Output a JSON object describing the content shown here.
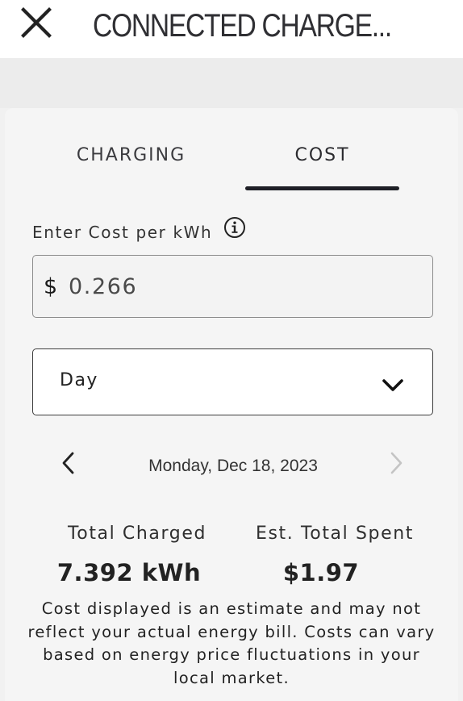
{
  "header": {
    "title": "CONNECTED CHARGE...",
    "close_icon": "close-icon"
  },
  "tabs": [
    {
      "label": "CHARGING",
      "active": false
    },
    {
      "label": "COST",
      "active": true
    }
  ],
  "cost": {
    "label": "Enter Cost per kWh",
    "info_icon": "info-icon",
    "currency": "$",
    "value": "0.266"
  },
  "period": {
    "selected": "Day",
    "icon": "chevron-down-icon"
  },
  "date_nav": {
    "date": "Monday, Dec 18, 2023",
    "prev_icon": "chevron-left-icon",
    "next_icon": "chevron-right-icon",
    "next_enabled": false
  },
  "stats": {
    "total_charged_label": "Total Charged",
    "total_charged_value": "7.392 kWh",
    "est_total_spent_label": "Est. Total Spent",
    "est_total_spent_value": "$1.97"
  },
  "disclaimer": "Cost displayed is an estimate and may not reflect your actual energy bill. Costs can vary based on energy price fluctuations in your local market.",
  "colors": {
    "accent": "#1e1f26",
    "background": "#f1f1f1",
    "disabled_icon": "#c4c4c4"
  }
}
